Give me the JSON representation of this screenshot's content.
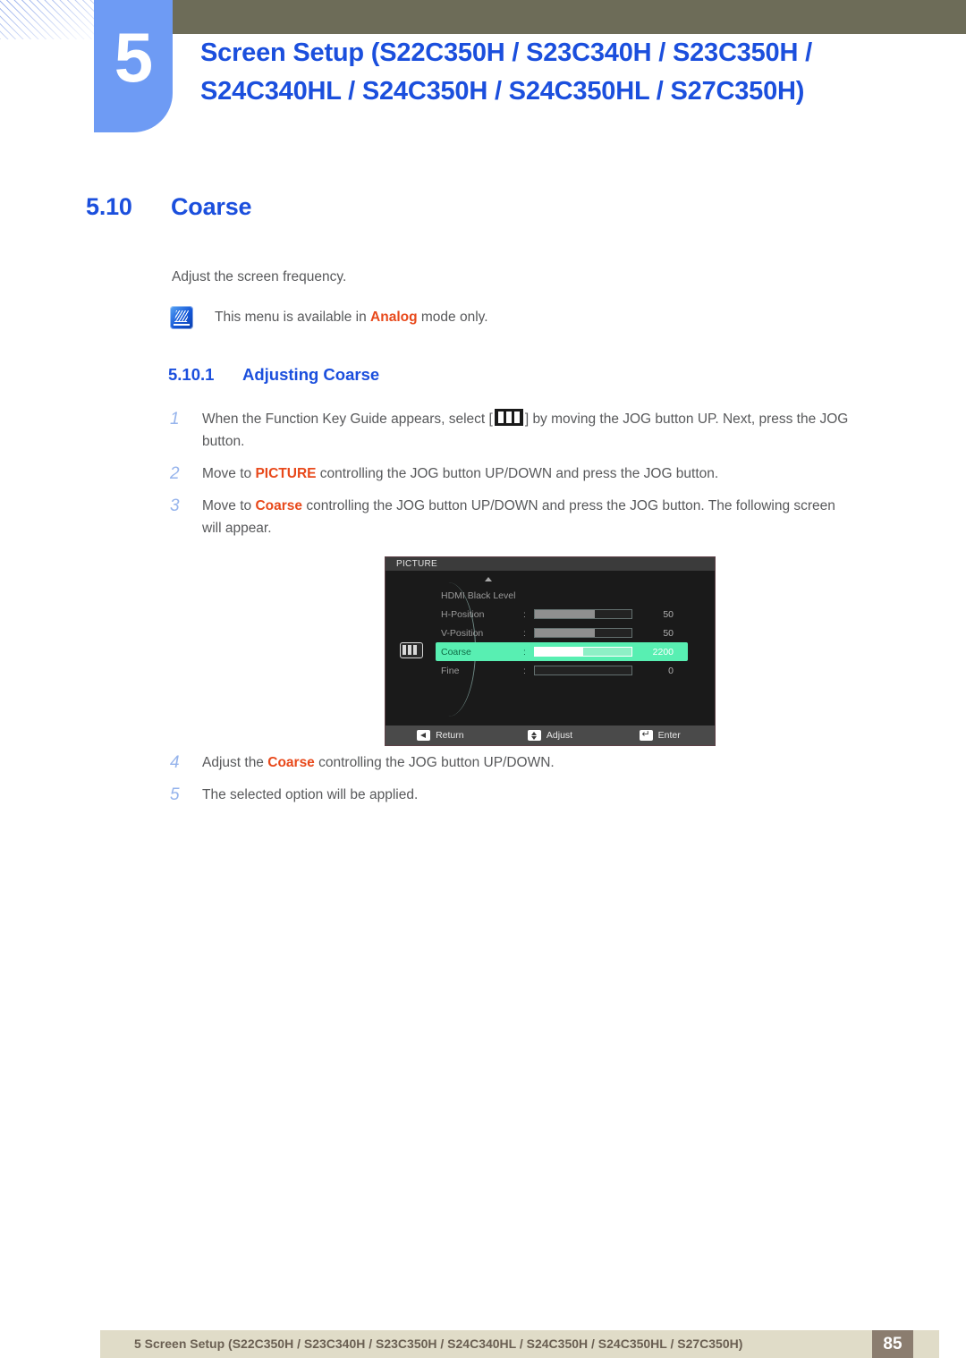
{
  "header": {
    "chapter_number": "5",
    "chapter_title": "Screen Setup (S22C350H / S23C340H / S23C350H / S24C340HL / S24C350H / S24C350HL / S27C350H)",
    "accent_color": "#1b4fdd",
    "tab_color": "#6e9bf4",
    "bar_color": "#6d6c58"
  },
  "section": {
    "number": "5.10",
    "title": "Coarse",
    "intro": "Adjust the screen frequency."
  },
  "note": {
    "icon": "note-pen-icon",
    "text_before": "This menu is available in ",
    "highlight": "Analog",
    "text_after": " mode only.",
    "highlight_color": "#e8491b"
  },
  "subsection": {
    "number": "5.10.1",
    "title": "Adjusting Coarse"
  },
  "steps": [
    {
      "num": "1",
      "parts": [
        {
          "type": "text",
          "value": "When the Function Key Guide appears, select ["
        },
        {
          "type": "icon",
          "value": "jog-function-key-icon"
        },
        {
          "type": "text",
          "value": "] by moving the JOG button UP. Next, press the JOG button."
        }
      ]
    },
    {
      "num": "2",
      "parts": [
        {
          "type": "text",
          "value": "Move to "
        },
        {
          "type": "highlight",
          "value": "PICTURE"
        },
        {
          "type": "text",
          "value": " controlling the JOG button UP/DOWN and press the JOG button."
        }
      ]
    },
    {
      "num": "3",
      "parts": [
        {
          "type": "text",
          "value": "Move to "
        },
        {
          "type": "highlight",
          "value": "Coarse"
        },
        {
          "type": "text",
          "value": " controlling the JOG button UP/DOWN and press the JOG button. The following screen will appear."
        }
      ]
    },
    {
      "num": "4",
      "parts": [
        {
          "type": "text",
          "value": "Adjust the "
        },
        {
          "type": "highlight",
          "value": "Coarse"
        },
        {
          "type": "text",
          "value": " controlling the JOG button UP/DOWN."
        }
      ]
    },
    {
      "num": "5",
      "parts": [
        {
          "type": "text",
          "value": "The selected option will be applied."
        }
      ]
    }
  ],
  "osd": {
    "title": "PICTURE",
    "category_icon": "picture-bars-icon",
    "scroll_up_icon": "scroll-up-arrow-icon",
    "items": [
      {
        "label": "HDMI Black Level",
        "colon": "",
        "has_bar": false,
        "value": "",
        "fill_percent": 0,
        "selected": false
      },
      {
        "label": "H-Position",
        "colon": ":",
        "has_bar": true,
        "value": "50",
        "fill_percent": 62,
        "selected": false
      },
      {
        "label": "V-Position",
        "colon": ":",
        "has_bar": true,
        "value": "50",
        "fill_percent": 62,
        "selected": false
      },
      {
        "label": "Coarse",
        "colon": ":",
        "has_bar": true,
        "value": "2200",
        "fill_percent": 50,
        "selected": true
      },
      {
        "label": "Fine",
        "colon": ":",
        "has_bar": true,
        "value": "0",
        "fill_percent": 0,
        "selected": false
      }
    ],
    "highlight_color": "#58efb2",
    "footer": [
      {
        "icon": "left-arrow-key-icon",
        "label": "Return"
      },
      {
        "icon": "up-down-arrow-key-icon",
        "label": "Adjust"
      },
      {
        "icon": "enter-key-icon",
        "label": "Enter"
      }
    ]
  },
  "footer": {
    "text": "5 Screen Setup (S22C350H / S23C340H / S23C350H / S24C340HL / S24C350H / S24C350HL / S27C350H)",
    "page_number": "85",
    "bar_color": "#e0dcc8",
    "page_box_color": "#8b7d6f"
  }
}
